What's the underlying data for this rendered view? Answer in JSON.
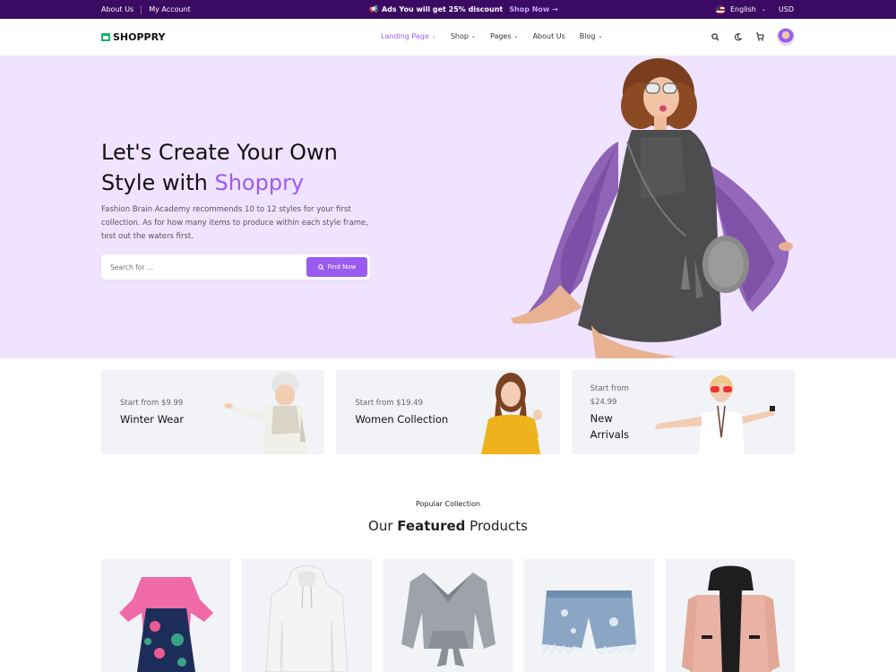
{
  "topbar": {
    "about": "About Us",
    "account": "My Account",
    "promo_icon": "📢",
    "promo_text": "Ads You will get 25% discount",
    "promo_link": "Shop Now →",
    "language": "English",
    "currency": "USD"
  },
  "nav": {
    "brand": "SHOPPRY",
    "items": [
      {
        "label": "Landing Page",
        "active": true
      },
      {
        "label": "Shop"
      },
      {
        "label": "Pages"
      },
      {
        "label": "About Us"
      },
      {
        "label": "Blog"
      }
    ],
    "icons": [
      "search-icon",
      "moon-icon",
      "cart-icon",
      "avatar"
    ]
  },
  "hero": {
    "title_line1": "Let's Create Your Own",
    "title_line2_prefix": "Style with ",
    "title_accent": "Shoppry",
    "description": "Fashion Brain Academy recommends 10 to 12 styles for your first collection. As for how many items to produce within each style frame, test out the waters first.",
    "search_placeholder": "Search for ...",
    "search_button": "Find Now"
  },
  "categories": [
    {
      "start": "Start from $9.99",
      "name": "Winter Wear"
    },
    {
      "start": "Start from $19.49",
      "name": "Women Collection"
    },
    {
      "start": "Start from $24.99",
      "name": "New Arrivals"
    }
  ],
  "section": {
    "eyebrow": "Popular Collection",
    "title_prefix": "Our ",
    "title_bold": "Featured",
    "title_suffix": " Products"
  },
  "colors": {
    "accent": "#9a5cf0",
    "topbar": "#3b0a63",
    "hero_bg": "#f0e3ff",
    "card_bg": "#f1f3f7"
  }
}
